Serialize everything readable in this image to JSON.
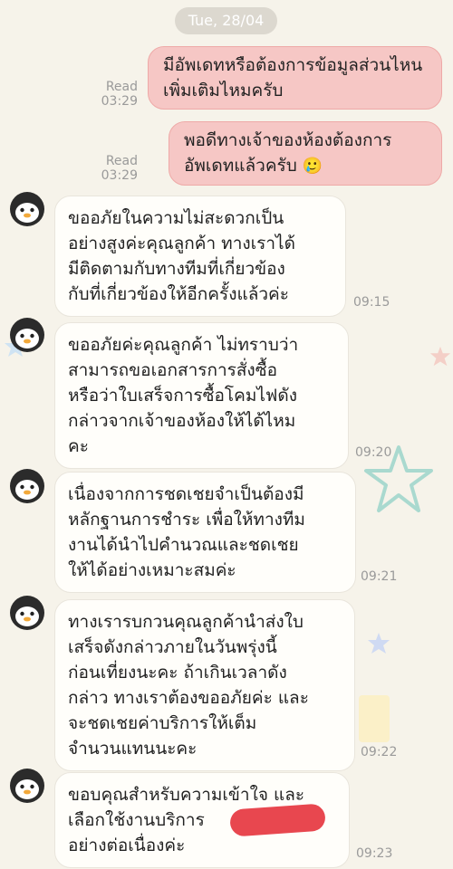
{
  "date_label": "Tue, 28/04",
  "outgoing": [
    {
      "text": "มีอัพเดทหรือต้องการข้อมูลส่วนไหนเพิ่มเติมไหมครับ",
      "status": "Read",
      "time": "03:29"
    },
    {
      "text": "พอดีทางเจ้าของห้องต้องการอัพเดทแล้วครับ",
      "emoji": "🥲",
      "status": "Read",
      "time": "03:29"
    }
  ],
  "incoming": [
    {
      "text": "ขออภัยในความไม่สะดวกเป็น\nอย่างสูงค่ะคุณลูกค้า ทางเราได้\nมีติดตามกับทางทีมที่เกี่ยวข้อง\nกับที่เกี่ยวข้องให้อีกครั้งแล้วค่ะ",
      "time": "09:15"
    },
    {
      "text": "ขออภัยค่ะคุณลูกค้า ไม่ทราบว่า\nสามารถขอเอกสารการสั่งซื้อ\nหรือว่าใบเสร็จการซื้อโคมไฟดัง\nกล่าวจากเจ้าของห้องให้ได้ไหม\nคะ",
      "time": "09:20"
    },
    {
      "text": "เนื่องจากการชดเชยจำเป็นต้องมี\nหลักฐานการชำระ เพื่อให้ทางทีม\nงานได้นำไปคำนวณและชดเชย\nให้ได้อย่างเหมาะสมค่ะ",
      "time": "09:21"
    },
    {
      "text": "ทางเรารบกวนคุณลูกค้านำส่งใบ\nเสร็จดังกล่าวภายในวันพรุ่งนี้\nก่อนเที่ยงนะคะ ถ้าเกินเวลาดัง\nกล่าว ทางเราต้องขออภัยค่ะ และ\nจะชดเชยค่าบริการให้เต็ม\nจำนวนแทนนะคะ",
      "time": "09:22"
    },
    {
      "text": "ขอบคุณสำหรับความเข้าใจ และ\nเลือกใช้งานบริการ\nอย่างต่อเนื่องค่ะ",
      "time": "09:23"
    }
  ],
  "colors": {
    "background": "#f6f3ea",
    "outgoing_bubble": "#f6c7c5",
    "incoming_bubble": "#fffefa",
    "censor": "#e8474f"
  },
  "icons": {
    "avatar": "penguin-icon"
  }
}
